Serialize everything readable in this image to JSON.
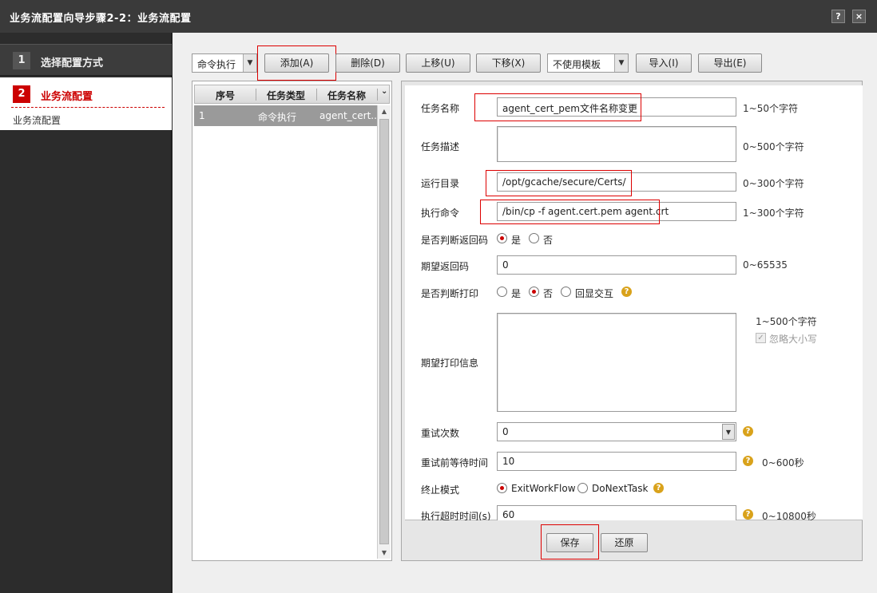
{
  "window": {
    "title": "业务流配置向导步骤2-2：业务流配置",
    "help_label": "?",
    "close_label": "×"
  },
  "wizard": {
    "steps": [
      {
        "num": "1",
        "label": "选择配置方式"
      },
      {
        "num": "2",
        "label": "业务流配置",
        "sub": "业务流配置"
      }
    ]
  },
  "toolbar": {
    "type_select": "命令执行",
    "add": "添加(A)",
    "delete": "删除(D)",
    "up": "上移(U)",
    "down": "下移(X)",
    "template_select": "不使用模板",
    "import": "导入(I)",
    "export": "导出(E)"
  },
  "tasklist": {
    "columns": [
      "序号",
      "任务类型",
      "任务名称"
    ],
    "rows": [
      {
        "seq": "1",
        "type": "命令执行",
        "name": "agent_cert..."
      }
    ]
  },
  "form": {
    "task_name": {
      "label": "任务名称",
      "value": "agent_cert_pem文件名称变更",
      "hint": "1~50个字符"
    },
    "task_desc": {
      "label": "任务描述",
      "value": "",
      "hint": "0~500个字符"
    },
    "run_dir": {
      "label": "运行目录",
      "value": "/opt/gcache/secure/Certs/",
      "hint": "0~300个字符"
    },
    "exec_cmd": {
      "label": "执行命令",
      "value": "/bin/cp -f agent.cert.pem agent.crt",
      "hint": "1~300个字符"
    },
    "check_return": {
      "label": "是否判断返回码",
      "yes": "是",
      "no": "否",
      "selected": "yes"
    },
    "expected_return": {
      "label": "期望返回码",
      "value": "0",
      "hint": "0~65535"
    },
    "check_print": {
      "label": "是否判断打印",
      "yes": "是",
      "no": "否",
      "echo": "回显交互",
      "selected": "no"
    },
    "expected_print": {
      "label": "期望打印信息",
      "value": "",
      "hint": "1~500个字符",
      "ignore_case": "忽略大小写"
    },
    "retry_count": {
      "label": "重试次数",
      "value": "0"
    },
    "retry_wait": {
      "label": "重试前等待时间",
      "value": "10",
      "hint": "0~600秒"
    },
    "stop_mode": {
      "label": "终止模式",
      "opt1": "ExitWorkFlow",
      "opt2": "DoNextTask",
      "selected": "opt1"
    },
    "exec_timeout": {
      "label": "执行超时时间(s)",
      "value": "60",
      "hint": "0~10800秒"
    }
  },
  "footer": {
    "save": "保存",
    "restore": "还原"
  },
  "colors": {
    "accent_red": "#cc0000",
    "help_icon": "#d9a21b"
  }
}
